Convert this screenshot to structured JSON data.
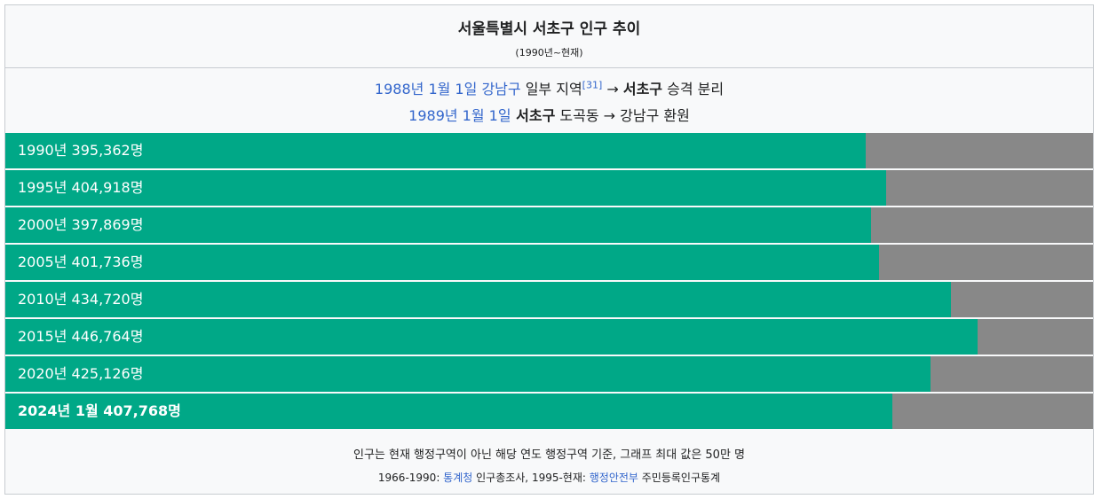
{
  "header": {
    "title": "서울특별시 서초구 인구 추이",
    "subtitle": "(1990년~현재)"
  },
  "history": {
    "line1": {
      "date_link": "1988년 1월 1일",
      "place_link": "강남구",
      "text_a": " 일부 지역",
      "ref": "[31]",
      "arrow": " → ",
      "dest": "서초구",
      "text_b": " 승격 분리"
    },
    "line2": {
      "date_link": "1989년 1월 1일",
      "source": " 서초구",
      "text_a": " 도곡동 → 강남구 환원"
    }
  },
  "chart_data": {
    "type": "bar",
    "orientation": "horizontal",
    "max_value": 500000,
    "colors": {
      "fill": "#00a887",
      "track": "#888888"
    },
    "rows": [
      {
        "year": "1990년",
        "value": 395362,
        "label": "1990년 395,362명",
        "bold": false
      },
      {
        "year": "1995년",
        "value": 404918,
        "label": "1995년 404,918명",
        "bold": false
      },
      {
        "year": "2000년",
        "value": 397869,
        "label": "2000년 397,869명",
        "bold": false
      },
      {
        "year": "2005년",
        "value": 401736,
        "label": "2005년 401,736명",
        "bold": false
      },
      {
        "year": "2010년",
        "value": 434720,
        "label": "2010년 434,720명",
        "bold": false
      },
      {
        "year": "2015년",
        "value": 446764,
        "label": "2015년 446,764명",
        "bold": false
      },
      {
        "year": "2020년",
        "value": 425126,
        "label": "2020년 425,126명",
        "bold": false
      },
      {
        "year": "2024년 1월",
        "value": 407768,
        "label": "2024년 1월 407,768명",
        "bold": true
      }
    ]
  },
  "footer": {
    "note": "인구는 현재 행정구역이 아닌 해당 연도 행정구역 기준, 그래프 최대 값은 50만 명",
    "source_a": "1966-1990: ",
    "source_link1": "통계청",
    "source_b": " 인구총조사, 1995-현재: ",
    "source_link2": "행정안전부",
    "source_c": " 주민등록인구통계"
  }
}
